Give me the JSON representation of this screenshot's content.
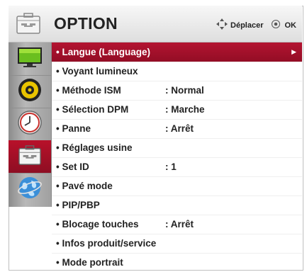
{
  "header": {
    "title": "OPTION",
    "move_label": "Déplacer",
    "ok_label": "OK"
  },
  "sidebar": {
    "items": [
      {
        "name": "picture-icon"
      },
      {
        "name": "speaker-icon"
      },
      {
        "name": "clock-icon"
      },
      {
        "name": "toolbox-icon",
        "active": true
      },
      {
        "name": "globe-icon"
      }
    ]
  },
  "menu": {
    "items": [
      {
        "label": "• Langue (Language)",
        "value": "",
        "selected": true
      },
      {
        "label": "• Voyant lumineux",
        "value": ""
      },
      {
        "label": "• Méthode ISM",
        "value": ": Normal"
      },
      {
        "label": "• Sélection DPM",
        "value": ": Marche"
      },
      {
        "label": "• Panne",
        "value": ": Arrêt"
      },
      {
        "label": "• Réglages usine",
        "value": ""
      },
      {
        "label": "• Set ID",
        "value": ": 1"
      },
      {
        "label": "• Pavé mode",
        "value": ""
      },
      {
        "label": "• PIP/PBP",
        "value": ""
      },
      {
        "label": "• Blocage touches",
        "value": ": Arrêt"
      },
      {
        "label": "• Infos produit/service",
        "value": ""
      },
      {
        "label": "• Mode portrait",
        "value": ""
      }
    ]
  },
  "colors": {
    "accent": "#a8112c",
    "header_bg": "#e6e6e6",
    "sidebar_bg": "#a6a6a6"
  }
}
